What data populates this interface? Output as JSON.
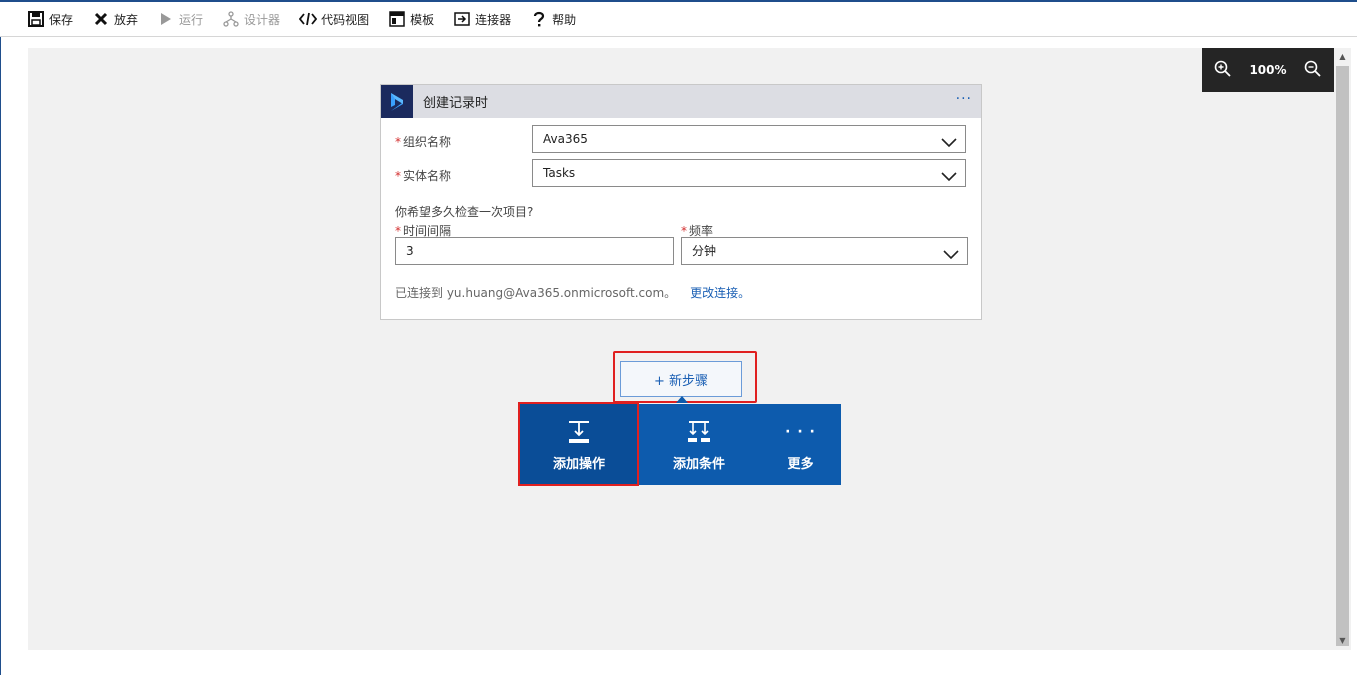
{
  "toolbar": {
    "items": [
      {
        "label": "保存",
        "icon": "save-icon"
      },
      {
        "label": "放弃",
        "icon": "discard-icon"
      },
      {
        "label": "运行",
        "icon": "run-icon"
      },
      {
        "label": "设计器",
        "icon": "designer-icon"
      },
      {
        "label": "代码视图",
        "icon": "code-view-icon"
      },
      {
        "label": "模板",
        "icon": "template-icon"
      },
      {
        "label": "连接器",
        "icon": "connector-icon"
      },
      {
        "label": "帮助",
        "icon": "help-icon"
      }
    ]
  },
  "zoom": {
    "level": "100%",
    "zoom_in_icon": "zoom-in-icon",
    "zoom_out_icon": "zoom-out-icon"
  },
  "trigger_card": {
    "title": "创建记录时",
    "more_label": "···",
    "org_label": "组织名称",
    "org_value": "Ava365",
    "entity_label": "实体名称",
    "entity_value": "Tasks",
    "interval_question": "你希望多久检查一次项目?",
    "interval_label": "时间间隔",
    "interval_value": "3",
    "frequency_label": "频率",
    "frequency_value": "分钟",
    "required_mark": "*",
    "connected_text": "已连接到 yu.huang@Ava365.onmicrosoft.com。",
    "change_link": "更改连接。"
  },
  "new_step": {
    "label": "+ 新步骤"
  },
  "step_menu": {
    "add_action": "添加操作",
    "add_condition": "添加条件",
    "more": "更多",
    "more_dots": "· · ·"
  },
  "colors": {
    "accent": "#0d5bad",
    "highlight": "#e02020",
    "toolbar_dark": "#252525"
  }
}
